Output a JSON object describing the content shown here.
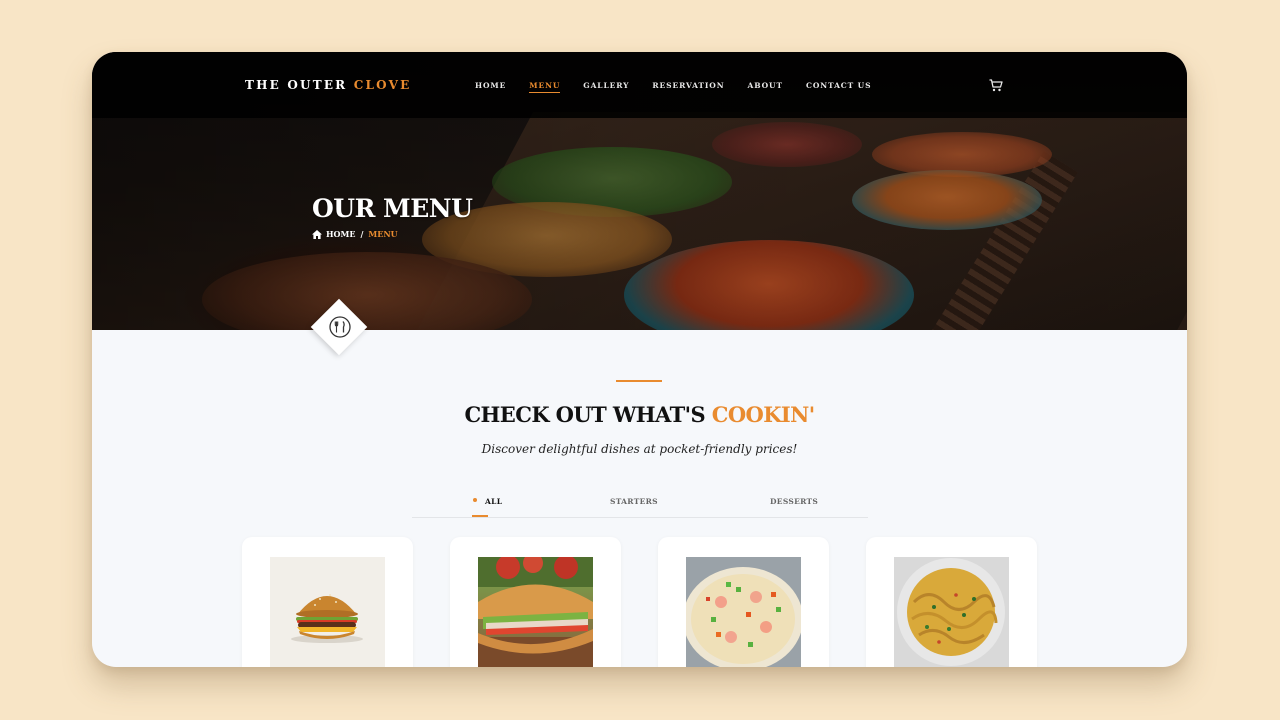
{
  "brand": {
    "name_main": "THE OUTER ",
    "name_accent": "CLOVE"
  },
  "nav": {
    "items": [
      {
        "label": "HOME",
        "active": false
      },
      {
        "label": "MENU",
        "active": true
      },
      {
        "label": "GALLERY",
        "active": false
      },
      {
        "label": "RESERVATION",
        "active": false
      },
      {
        "label": "ABOUT",
        "active": false
      },
      {
        "label": "CONTACT US",
        "active": false
      }
    ],
    "cart_icon": "cart-icon"
  },
  "hero": {
    "title": "OUR MENU",
    "breadcrumb": {
      "home_icon": "home-icon",
      "home": "HOME",
      "separator": "/",
      "current": "MENU"
    },
    "badge_icon": "cutlery-icon"
  },
  "section": {
    "title_main": "CHECK OUT WHAT'S ",
    "title_accent": "COOKIN'",
    "subtitle": "Discover delightful dishes at pocket-friendly prices!"
  },
  "tabs": [
    {
      "label": "ALL",
      "active": true
    },
    {
      "label": "STARTERS",
      "active": false
    },
    {
      "label": "DESSERTS",
      "active": false
    }
  ],
  "cards": [
    {
      "image": "burger-image"
    },
    {
      "image": "sandwich-image"
    },
    {
      "image": "fried-rice-image"
    },
    {
      "image": "noodles-image"
    }
  ],
  "colors": {
    "accent": "#e98b2f",
    "page_bg": "#f8e5c6",
    "section_bg": "#f6f8fb",
    "nav_bg": "#000000"
  }
}
